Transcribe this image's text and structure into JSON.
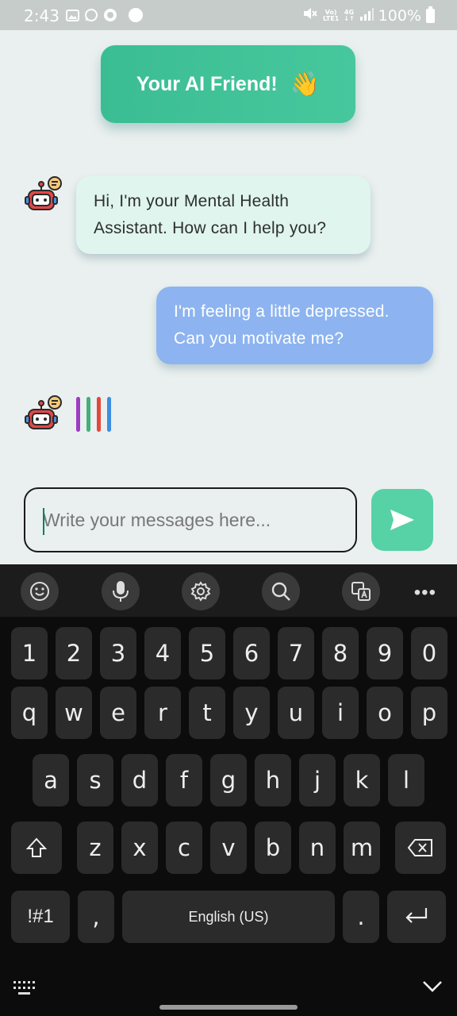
{
  "status_bar": {
    "time": "2:43",
    "network_top": "Vo)",
    "network_bottom": "LTE1",
    "gen_top": "4G",
    "gen_bottom": "↓↑",
    "battery": "100%"
  },
  "header": {
    "title": "Your AI Friend!",
    "emoji": "👋"
  },
  "chat": {
    "messages": [
      {
        "from": "bot",
        "text": "Hi, I'm your Mental Health Assistant. How can I help you?"
      },
      {
        "from": "user",
        "text": "I'm feeling a little depressed. Can you motivate me?"
      }
    ],
    "typing_colors": [
      "#9c3ec0",
      "#43b07a",
      "#e4473a",
      "#3e8ee0"
    ]
  },
  "composer": {
    "placeholder": "Write your messages here...",
    "value": ""
  },
  "keyboard": {
    "number_row": [
      "1",
      "2",
      "3",
      "4",
      "5",
      "6",
      "7",
      "8",
      "9",
      "0"
    ],
    "row1": [
      "q",
      "w",
      "e",
      "r",
      "t",
      "y",
      "u",
      "i",
      "o",
      "p"
    ],
    "row2": [
      "a",
      "s",
      "d",
      "f",
      "g",
      "h",
      "j",
      "k",
      "l"
    ],
    "row3": [
      "z",
      "x",
      "c",
      "v",
      "b",
      "n",
      "m"
    ],
    "symbols_label": "!#1",
    "comma": ",",
    "space_label": "English (US)",
    "period": ".",
    "more": "•••"
  },
  "colors": {
    "accent": "#3bbd93",
    "user_bubble": "#8db4f0",
    "bot_bubble": "#dff5ee",
    "send": "#56d2a6"
  }
}
